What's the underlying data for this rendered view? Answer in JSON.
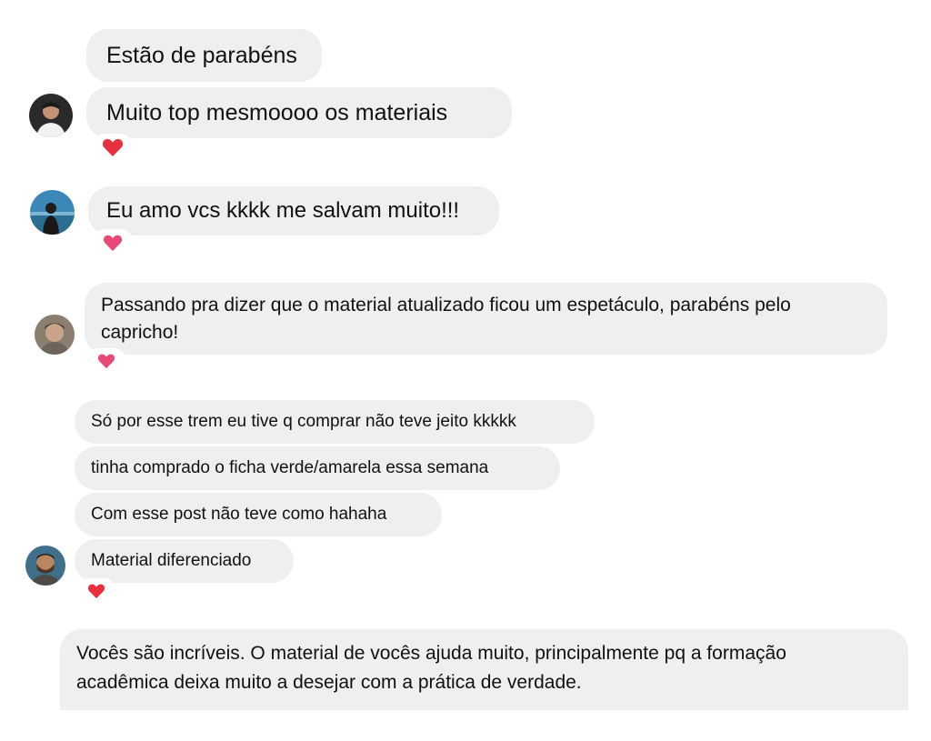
{
  "messages": [
    {
      "text": "Estão de parabéns"
    },
    {
      "text": "Muito top mesmoooo os materiais"
    },
    {
      "text": "Eu amo vcs kkkk me salvam muito!!!"
    },
    {
      "text": "Passando pra dizer que o material atualizado ficou um espetáculo, parabéns pelo capricho!"
    },
    {
      "text": "Só por esse trem eu tive q comprar não teve jeito kkkkk"
    },
    {
      "text": "tinha comprado o ficha verde/amarela essa semana"
    },
    {
      "text": "Com esse post não teve como hahaha"
    },
    {
      "text": "Material diferenciado"
    },
    {
      "text": "Vocês são incríveis. O material de vocês ajuda muito, principalmente pq a formação acadêmica deixa muito a desejar com a prática de verdade."
    }
  ],
  "reactions": [
    {
      "icon": "heart-icon",
      "color": "#e8303e"
    },
    {
      "icon": "heart-icon",
      "color": "#e84a78"
    },
    {
      "icon": "heart-icon",
      "color": "#e84a78"
    },
    {
      "icon": "heart-icon",
      "color": "#e8303e"
    }
  ]
}
